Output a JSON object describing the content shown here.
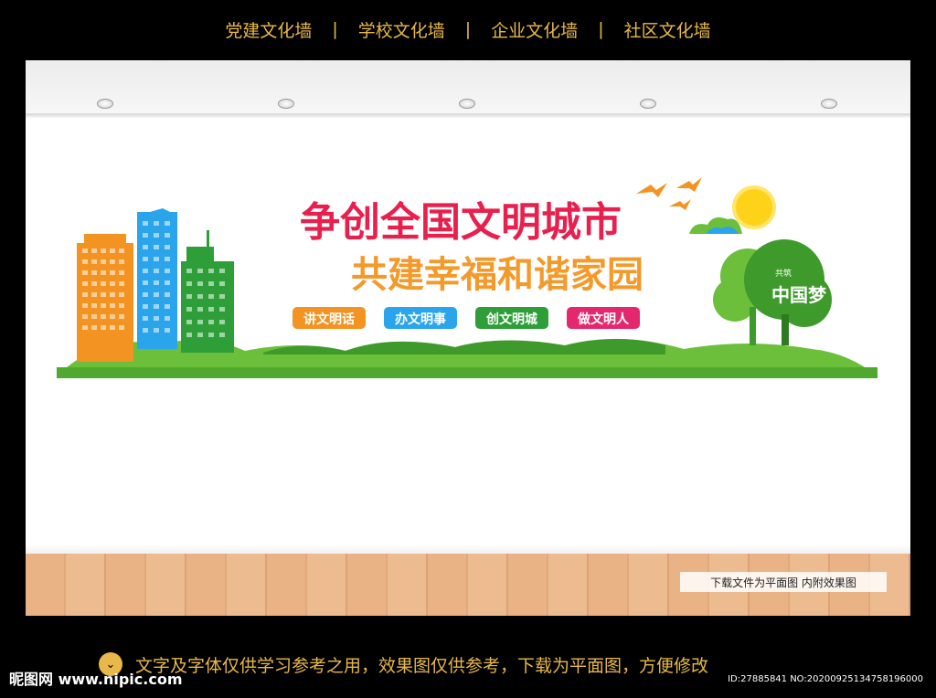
{
  "top_nav": {
    "items": [
      "党建文化墙",
      "学校文化墙",
      "企业文化墙",
      "社区文化墙"
    ],
    "separator": "|"
  },
  "banner": {
    "title_line1": "争创全国文明城市",
    "title_line2": "共建幸福和谐家园",
    "tags": [
      "讲文明话",
      "办文明事",
      "创文明城",
      "做文明人"
    ],
    "tree_logo_small": "共筑",
    "tree_logo_main": "中国梦"
  },
  "floor_note": "下载文件为平面图  内附效果图",
  "bottom": {
    "logo": "昵图网 www.nipic.com",
    "notice": "文字及字体仅供学习参考之用，效果图仅供参考，下载为平面图，方便修改",
    "id_text": "ID:27885841 NO:20200925134758196000"
  },
  "colors": {
    "nav_text": "#e8b84a",
    "title_red": "#e8204e",
    "title_orange": "#f39a2a",
    "tag_orange": "#f39322",
    "tag_blue": "#2aa4ea",
    "tag_green": "#2e9e38",
    "tag_magenta": "#e5286e",
    "grass_green": "#6bbf3a",
    "sun_yellow": "#ffd21a"
  },
  "icons": [
    "chevron-down-icon",
    "bird-icon",
    "sun-icon",
    "cloud-icon",
    "tree-icon"
  ]
}
